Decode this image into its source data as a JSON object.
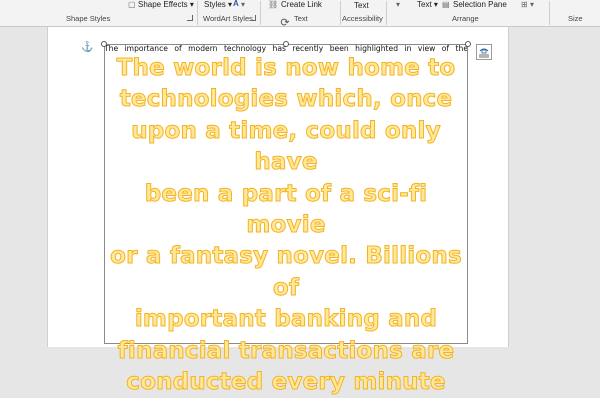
{
  "ribbon": {
    "shape_effects_label": "Shape Effects",
    "shape_effects_caret": "▾",
    "styles_label": "Styles",
    "styles_caret": "▾",
    "create_link_label": "Create Link",
    "text_button_label": "Text",
    "text_dropdown_label": "Text",
    "text_dropdown_caret": "▾",
    "selection_pane_label": "Selection Pane",
    "groups": {
      "shape_styles": "Shape Styles",
      "wordart_styles": "WordArt Styles",
      "text": "Text",
      "accessibility": "Accessibility",
      "arrange": "Arrange",
      "size": "Size"
    }
  },
  "document": {
    "body_line": "The importance of modern technology has recently been highlighted in view of the",
    "anchor_glyph": "⚓",
    "wordart_lines": [
      "The world is now home to",
      "technologies which, once",
      "upon a time, could only have",
      "been a part of a sci-fi movie",
      "or a fantasy novel. Billions of",
      "important banking and",
      "financial transactions are",
      "conducted every minute"
    ],
    "colors": {
      "wordart_fill": "#ffe89a",
      "wordart_outline": "#f3b323"
    }
  }
}
